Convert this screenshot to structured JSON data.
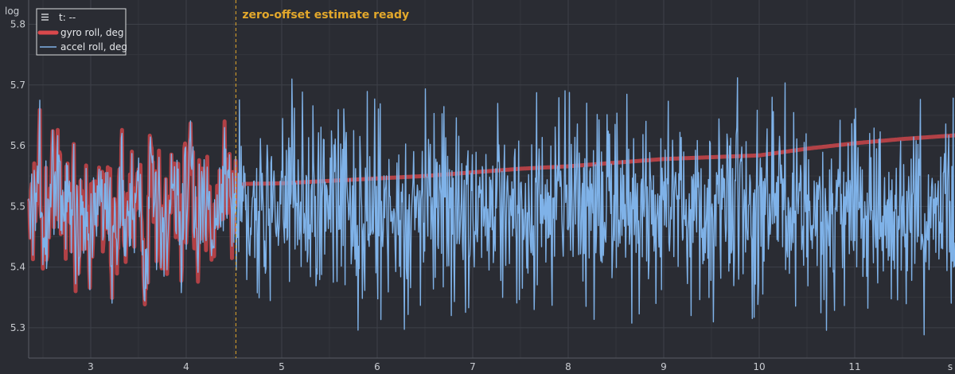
{
  "chart_data": {
    "type": "line",
    "title": "",
    "xlabel": "s",
    "ylabel": "log",
    "xlim": [
      2.35,
      12.05
    ],
    "ylim": [
      5.25,
      5.84
    ],
    "x_ticks": [
      3,
      4,
      5,
      6,
      7,
      8,
      9,
      10,
      11
    ],
    "y_ticks": [
      5.3,
      5.4,
      5.5,
      5.6,
      5.7,
      5.8
    ],
    "grid": true,
    "legend": {
      "placement": "top-left",
      "readout": "t: --",
      "entries": [
        "gyro roll, deg",
        "accel roll, deg"
      ]
    },
    "annotation": {
      "x": 4.52,
      "text": "zero-offset estimate ready"
    },
    "colors": {
      "background": "#2a2c33",
      "grid": "#3e4149",
      "gyro": "#d9484c",
      "accel": "#7fb2e8",
      "marker": "#e3a82b"
    },
    "series": [
      {
        "name": "gyro roll, deg",
        "x": [
          2.35,
          4.52,
          4.6,
          5.0,
          5.5,
          6.0,
          6.5,
          7.0,
          7.5,
          8.0,
          8.5,
          9.0,
          9.5,
          10.0,
          10.5,
          11.0,
          11.5,
          12.05
        ],
        "values": [
          5.5,
          5.5,
          5.537,
          5.538,
          5.542,
          5.546,
          5.55,
          5.556,
          5.562,
          5.566,
          5.572,
          5.578,
          5.581,
          5.584,
          5.595,
          5.604,
          5.611,
          5.617
        ],
        "early_noise": {
          "x_end": 4.52,
          "amplitude": 0.24
        }
      },
      {
        "name": "accel roll, deg",
        "x": [
          2.35,
          4.52,
          12.05
        ],
        "values": [
          5.5,
          5.5,
          5.5
        ],
        "noise": {
          "samples": 1500,
          "amplitude": 0.22,
          "follows_gyro_before": 4.52
        }
      }
    ]
  }
}
